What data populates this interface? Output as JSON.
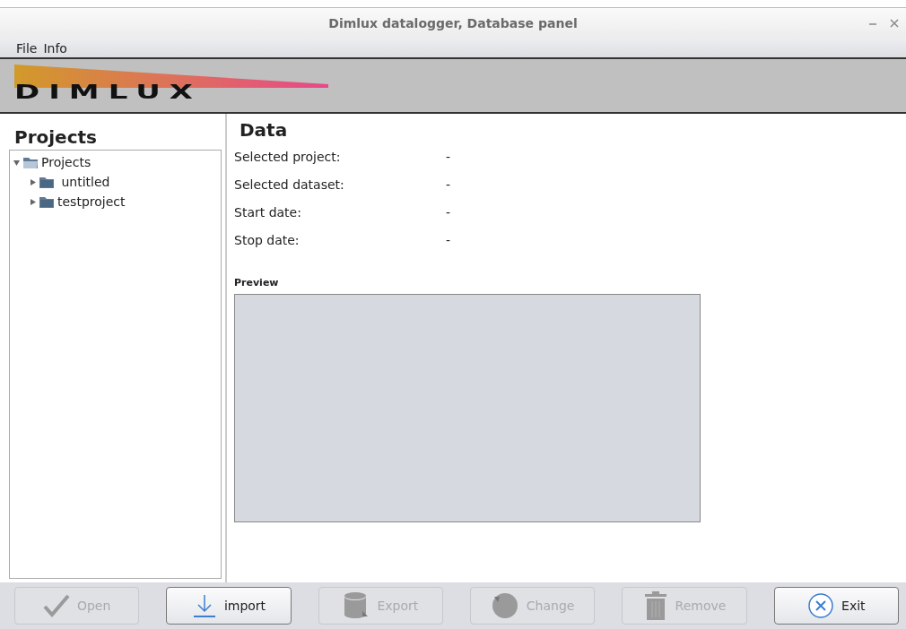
{
  "window": {
    "title": "Dimlux datalogger, Database panel"
  },
  "menu": [
    "File",
    "Info"
  ],
  "logo": {
    "text": "DIMLUX"
  },
  "projects": {
    "title": "Projects",
    "tree": [
      {
        "label": "Projects",
        "expanded": true,
        "children": [
          {
            "label": " untitled",
            "expanded": false
          },
          {
            "label": "testproject",
            "expanded": false
          }
        ]
      }
    ]
  },
  "data": {
    "title": "Data",
    "fields": [
      {
        "label": "Selected project:",
        "value": "-"
      },
      {
        "label": "Selected dataset:",
        "value": "-"
      },
      {
        "label": "Start date:",
        "value": "-"
      },
      {
        "label": "Stop date:",
        "value": "-"
      }
    ],
    "preview_label": "Preview"
  },
  "buttons": [
    {
      "label": "Open",
      "kind": "check",
      "disabled": true
    },
    {
      "label": "import",
      "kind": "import",
      "disabled": false
    },
    {
      "label": "Export",
      "kind": "database",
      "disabled": true
    },
    {
      "label": "Change",
      "kind": "cycle",
      "disabled": true
    },
    {
      "label": "Remove",
      "kind": "trash",
      "disabled": true
    },
    {
      "label": "Exit",
      "kind": "exit",
      "disabled": false
    }
  ]
}
